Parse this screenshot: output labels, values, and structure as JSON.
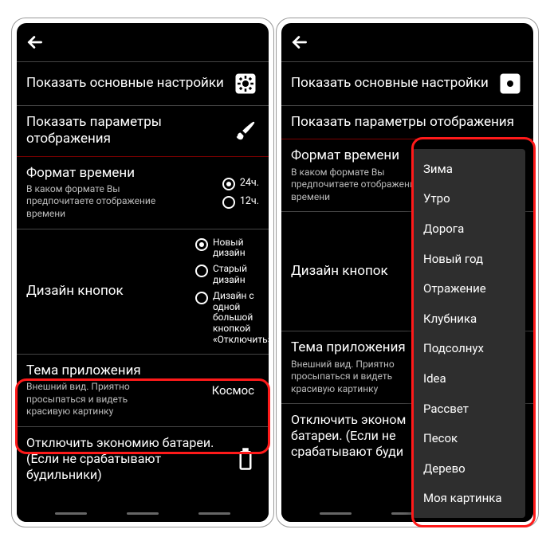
{
  "appbar": {
    "back": "←"
  },
  "rows": {
    "basic": {
      "title": "Показать основные настройки"
    },
    "display": {
      "title": "Показать параметры отображения"
    },
    "timefmt": {
      "title": "Формат времени",
      "sub": "В каком формате Вы предпочитаете отображение времени",
      "opt24": "24ч.",
      "opt12": "12ч."
    },
    "buttons": {
      "title": "Дизайн кнопок",
      "opt1": "Новый дизайн",
      "opt2": "Старый дизайн",
      "opt3": "Дизайн с одной большой кнопкой «Отключить»"
    },
    "theme": {
      "title": "Тема приложения",
      "sub": "Внешний вид. Приятно просыпаться и видеть красивую картинку",
      "value": "Космос"
    },
    "battery": {
      "title": "Отключить экономию батареи. (Если не срабатывают будильники)",
      "title_trunc": "Отключить эконом\nбатареи. (Если не\nсрабатывают буди"
    }
  },
  "dropdown": {
    "items": [
      "Зима",
      "Утро",
      "Дорога",
      "Новый год",
      "Отражение",
      "Клубника",
      "Подсолнух",
      "Idea",
      "Рассвет",
      "Песок",
      "Дерево",
      "Моя картинка"
    ]
  }
}
